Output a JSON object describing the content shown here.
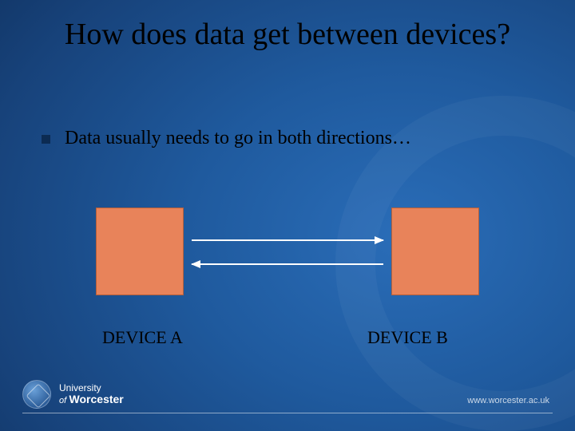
{
  "title": "How does data get between devices?",
  "bullet": {
    "text": "Data usually needs to go in both directions…"
  },
  "devices": {
    "a_label": "DEVICE A",
    "b_label": "DEVICE B",
    "box_color": "#e8835a"
  },
  "footer": {
    "institution_line1": "University",
    "institution_line2": "of",
    "institution_line3": "Worcester",
    "url": "www.worcester.ac.uk"
  }
}
